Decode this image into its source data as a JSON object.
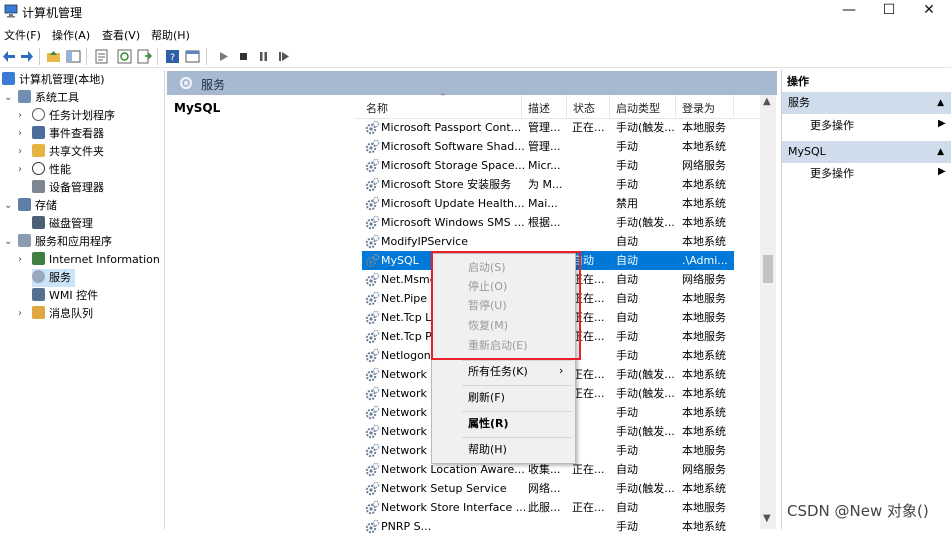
{
  "window": {
    "title": "计算机管理"
  },
  "menubar": [
    "文件(F)",
    "操作(A)",
    "查看(V)",
    "帮助(H)"
  ],
  "tree": [
    {
      "label": "计算机管理(本地)",
      "level": 0
    },
    {
      "label": "系统工具",
      "level": 1,
      "expanded": true
    },
    {
      "label": "任务计划程序",
      "level": 2
    },
    {
      "label": "事件查看器",
      "level": 2
    },
    {
      "label": "共享文件夹",
      "level": 2
    },
    {
      "label": "性能",
      "level": 2
    },
    {
      "label": "设备管理器",
      "level": 2
    },
    {
      "label": "存储",
      "level": 1,
      "expanded": true
    },
    {
      "label": "磁盘管理",
      "level": 2
    },
    {
      "label": "服务和应用程序",
      "level": 1,
      "expanded": true
    },
    {
      "label": "Internet Information S",
      "level": 2
    },
    {
      "label": "服务",
      "level": 2,
      "selected": true
    },
    {
      "label": "WMI 控件",
      "level": 2
    },
    {
      "label": "消息队列",
      "level": 2
    }
  ],
  "header": {
    "title": "服务",
    "selected_service": "MySQL"
  },
  "columns": [
    "名称",
    "描述",
    "状态",
    "启动类型",
    "登录为"
  ],
  "services": [
    [
      "Microsoft Passport Cont...",
      "管理...",
      "正在...",
      "手动(触发...",
      "本地服务"
    ],
    [
      "Microsoft Software Shad...",
      "管理...",
      "",
      "手动",
      "本地系统"
    ],
    [
      "Microsoft Storage Space...",
      "Micr...",
      "",
      "手动",
      "网络服务"
    ],
    [
      "Microsoft Store 安装服务",
      "为 M...",
      "",
      "手动",
      "本地系统"
    ],
    [
      "Microsoft Update Health...",
      "Mai...",
      "",
      "禁用",
      "本地系统"
    ],
    [
      "Microsoft Windows SMS ...",
      "根据...",
      "",
      "手动(触发...",
      "本地系统"
    ],
    [
      "ModifyIPService",
      "",
      "",
      "自动",
      "本地系统"
    ],
    [
      "MySQL",
      "",
      "自动",
      "自动",
      ".\\Admi..."
    ],
    [
      "Net.Msmq",
      "",
      "正在...",
      "自动",
      "网络服务"
    ],
    [
      "Net.Pipe Li",
      "",
      "正在...",
      "自动",
      "本地服务"
    ],
    [
      "Net.Tcp Li",
      "",
      "正在...",
      "自动",
      "本地服务"
    ],
    [
      "Net.Tcp P",
      "",
      "正在...",
      "手动",
      "本地服务"
    ],
    [
      "Netlogon",
      "",
      "",
      "手动",
      "本地系统"
    ],
    [
      "Network C",
      "",
      "正在...",
      "手动(触发...",
      "本地系统"
    ],
    [
      "Network C",
      "",
      "正在...",
      "手动(触发...",
      "本地系统"
    ],
    [
      "Network C",
      "",
      "",
      "手动",
      "本地系统"
    ],
    [
      "Network C",
      "",
      "",
      "手动(触发...",
      "本地系统"
    ],
    [
      "Network L",
      "",
      "",
      "手动",
      "本地服务"
    ],
    [
      "Network Location Aware...",
      "收集...",
      "正在...",
      "自动",
      "网络服务"
    ],
    [
      "Network Setup Service",
      "网络...",
      "",
      "手动(触发...",
      "本地系统"
    ],
    [
      "Network Store Interface ...",
      "此服...",
      "正在...",
      "自动",
      "本地服务"
    ],
    [
      "PNRP S...",
      "",
      "",
      "手动",
      "本地系统"
    ]
  ],
  "actions": {
    "header": "操作",
    "sections": [
      {
        "title": "服务",
        "item": "更多操作"
      },
      {
        "title": "MySQL",
        "item": "更多操作"
      }
    ]
  },
  "context_menu": {
    "items": [
      {
        "label": "启动(S)",
        "disabled": true
      },
      {
        "label": "停止(O)",
        "disabled": true
      },
      {
        "label": "暂停(U)",
        "disabled": true
      },
      {
        "label": "恢复(M)",
        "disabled": true
      },
      {
        "label": "重新启动(E)",
        "disabled": true
      },
      {
        "label": "所有任务(K)",
        "submenu": true
      },
      {
        "label": "刷新(F)"
      },
      {
        "label": "属性(R)",
        "bold": true
      },
      {
        "label": "帮助(H)"
      }
    ]
  },
  "watermark": "CSDN @New 对象()",
  "colors": {
    "selection": "#0078d7",
    "header_band": "#a7b8d1",
    "action_section": "#cfdcec",
    "highlight_box": "#e6212a"
  }
}
